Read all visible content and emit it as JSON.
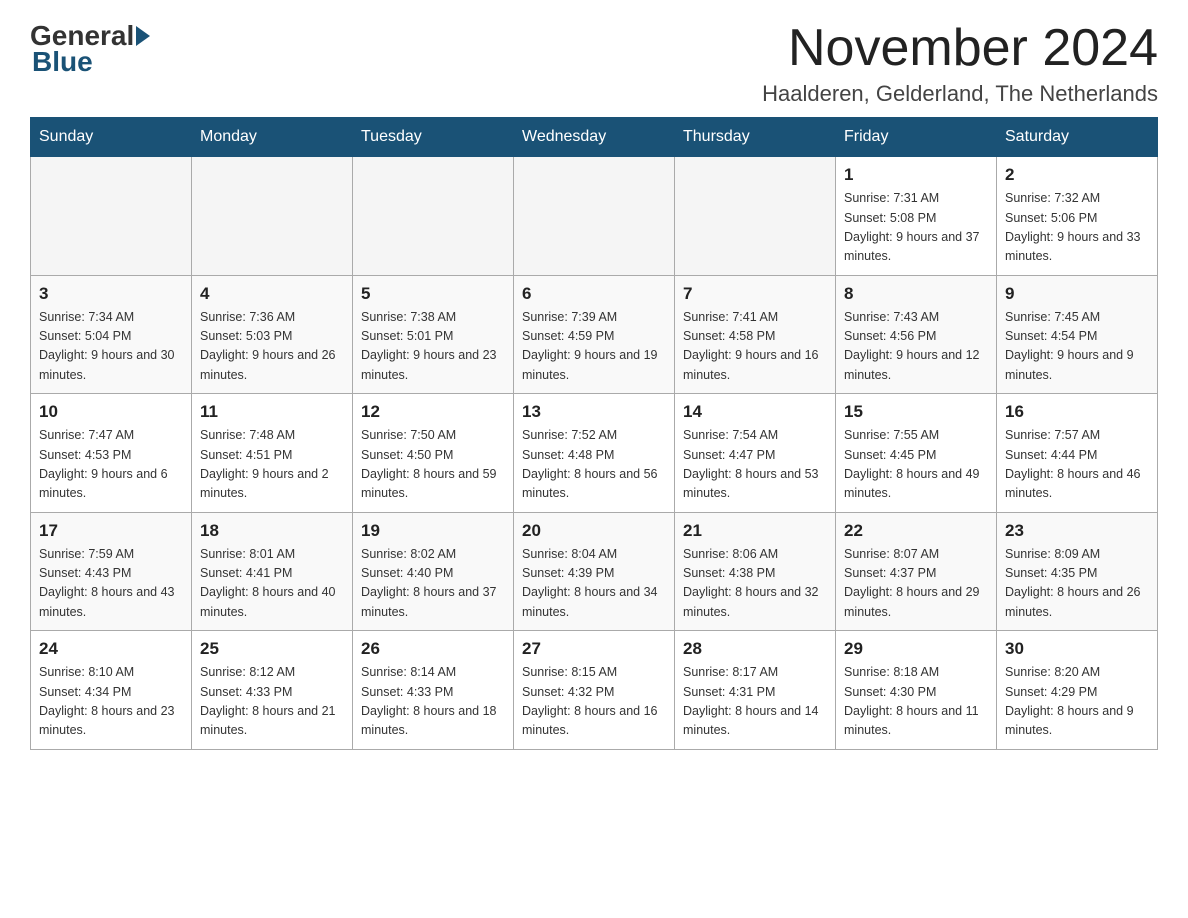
{
  "header": {
    "logo_general": "General",
    "logo_blue": "Blue",
    "month_title": "November 2024",
    "location": "Haalderen, Gelderland, The Netherlands"
  },
  "weekdays": [
    "Sunday",
    "Monday",
    "Tuesday",
    "Wednesday",
    "Thursday",
    "Friday",
    "Saturday"
  ],
  "weeks": [
    [
      {
        "day": "",
        "info": ""
      },
      {
        "day": "",
        "info": ""
      },
      {
        "day": "",
        "info": ""
      },
      {
        "day": "",
        "info": ""
      },
      {
        "day": "",
        "info": ""
      },
      {
        "day": "1",
        "info": "Sunrise: 7:31 AM\nSunset: 5:08 PM\nDaylight: 9 hours and 37 minutes."
      },
      {
        "day": "2",
        "info": "Sunrise: 7:32 AM\nSunset: 5:06 PM\nDaylight: 9 hours and 33 minutes."
      }
    ],
    [
      {
        "day": "3",
        "info": "Sunrise: 7:34 AM\nSunset: 5:04 PM\nDaylight: 9 hours and 30 minutes."
      },
      {
        "day": "4",
        "info": "Sunrise: 7:36 AM\nSunset: 5:03 PM\nDaylight: 9 hours and 26 minutes."
      },
      {
        "day": "5",
        "info": "Sunrise: 7:38 AM\nSunset: 5:01 PM\nDaylight: 9 hours and 23 minutes."
      },
      {
        "day": "6",
        "info": "Sunrise: 7:39 AM\nSunset: 4:59 PM\nDaylight: 9 hours and 19 minutes."
      },
      {
        "day": "7",
        "info": "Sunrise: 7:41 AM\nSunset: 4:58 PM\nDaylight: 9 hours and 16 minutes."
      },
      {
        "day": "8",
        "info": "Sunrise: 7:43 AM\nSunset: 4:56 PM\nDaylight: 9 hours and 12 minutes."
      },
      {
        "day": "9",
        "info": "Sunrise: 7:45 AM\nSunset: 4:54 PM\nDaylight: 9 hours and 9 minutes."
      }
    ],
    [
      {
        "day": "10",
        "info": "Sunrise: 7:47 AM\nSunset: 4:53 PM\nDaylight: 9 hours and 6 minutes."
      },
      {
        "day": "11",
        "info": "Sunrise: 7:48 AM\nSunset: 4:51 PM\nDaylight: 9 hours and 2 minutes."
      },
      {
        "day": "12",
        "info": "Sunrise: 7:50 AM\nSunset: 4:50 PM\nDaylight: 8 hours and 59 minutes."
      },
      {
        "day": "13",
        "info": "Sunrise: 7:52 AM\nSunset: 4:48 PM\nDaylight: 8 hours and 56 minutes."
      },
      {
        "day": "14",
        "info": "Sunrise: 7:54 AM\nSunset: 4:47 PM\nDaylight: 8 hours and 53 minutes."
      },
      {
        "day": "15",
        "info": "Sunrise: 7:55 AM\nSunset: 4:45 PM\nDaylight: 8 hours and 49 minutes."
      },
      {
        "day": "16",
        "info": "Sunrise: 7:57 AM\nSunset: 4:44 PM\nDaylight: 8 hours and 46 minutes."
      }
    ],
    [
      {
        "day": "17",
        "info": "Sunrise: 7:59 AM\nSunset: 4:43 PM\nDaylight: 8 hours and 43 minutes."
      },
      {
        "day": "18",
        "info": "Sunrise: 8:01 AM\nSunset: 4:41 PM\nDaylight: 8 hours and 40 minutes."
      },
      {
        "day": "19",
        "info": "Sunrise: 8:02 AM\nSunset: 4:40 PM\nDaylight: 8 hours and 37 minutes."
      },
      {
        "day": "20",
        "info": "Sunrise: 8:04 AM\nSunset: 4:39 PM\nDaylight: 8 hours and 34 minutes."
      },
      {
        "day": "21",
        "info": "Sunrise: 8:06 AM\nSunset: 4:38 PM\nDaylight: 8 hours and 32 minutes."
      },
      {
        "day": "22",
        "info": "Sunrise: 8:07 AM\nSunset: 4:37 PM\nDaylight: 8 hours and 29 minutes."
      },
      {
        "day": "23",
        "info": "Sunrise: 8:09 AM\nSunset: 4:35 PM\nDaylight: 8 hours and 26 minutes."
      }
    ],
    [
      {
        "day": "24",
        "info": "Sunrise: 8:10 AM\nSunset: 4:34 PM\nDaylight: 8 hours and 23 minutes."
      },
      {
        "day": "25",
        "info": "Sunrise: 8:12 AM\nSunset: 4:33 PM\nDaylight: 8 hours and 21 minutes."
      },
      {
        "day": "26",
        "info": "Sunrise: 8:14 AM\nSunset: 4:33 PM\nDaylight: 8 hours and 18 minutes."
      },
      {
        "day": "27",
        "info": "Sunrise: 8:15 AM\nSunset: 4:32 PM\nDaylight: 8 hours and 16 minutes."
      },
      {
        "day": "28",
        "info": "Sunrise: 8:17 AM\nSunset: 4:31 PM\nDaylight: 8 hours and 14 minutes."
      },
      {
        "day": "29",
        "info": "Sunrise: 8:18 AM\nSunset: 4:30 PM\nDaylight: 8 hours and 11 minutes."
      },
      {
        "day": "30",
        "info": "Sunrise: 8:20 AM\nSunset: 4:29 PM\nDaylight: 8 hours and 9 minutes."
      }
    ]
  ]
}
